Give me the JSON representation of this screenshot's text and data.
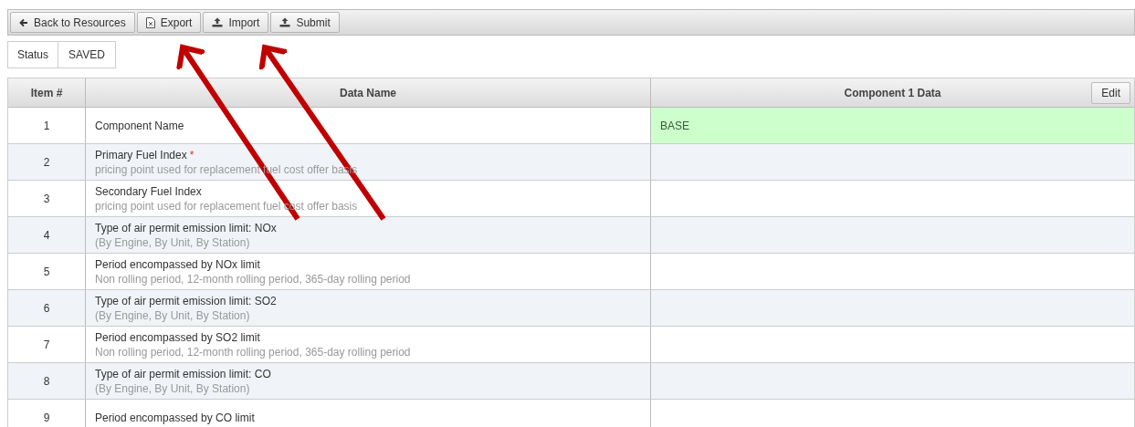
{
  "toolbar": [
    {
      "kind": "back",
      "label": "Back to Resources"
    },
    {
      "kind": "export",
      "label": "Export"
    },
    {
      "kind": "import",
      "label": "Import"
    },
    {
      "kind": "submit",
      "label": "Submit"
    }
  ],
  "status": {
    "label": "Status",
    "value": "SAVED"
  },
  "table": {
    "columns": [
      "Item #",
      "Data Name",
      "Component 1 Data"
    ],
    "edit_button": "Edit",
    "rows": [
      {
        "item": "1",
        "name": "Component Name",
        "value": "BASE",
        "highlighted": true
      },
      {
        "item": "2",
        "name": "Primary Fuel Index",
        "required_mark": "*",
        "description": "pricing point used for replacement fuel cost offer basis",
        "highlighted": false
      },
      {
        "item": "3",
        "name": "Secondary Fuel Index",
        "description": "pricing point used for replacement fuel cost offer basis",
        "highlighted": false
      },
      {
        "item": "4",
        "name": "Type of air permit emission limit: NOx",
        "description": "(By Engine, By Unit, By Station)",
        "highlighted": false
      },
      {
        "item": "5",
        "name": "Period encompassed by NOx limit",
        "description": "Non rolling period, 12-month rolling period, 365-day rolling period",
        "highlighted": false
      },
      {
        "item": "6",
        "name": "Type of air permit emission limit: SO2",
        "description": "(By Engine, By Unit, By Station)",
        "highlighted": false
      },
      {
        "item": "7",
        "name": "Period encompassed by SO2 limit",
        "description": "Non rolling period, 12-month rolling period, 365-day rolling period",
        "highlighted": false
      },
      {
        "item": "8",
        "name": "Type of air permit emission limit: CO",
        "description": "(By Engine, By Unit, By Station)",
        "highlighted": false
      },
      {
        "item": "9",
        "name": "Period encompassed by CO limit",
        "highlighted": false
      }
    ]
  }
}
